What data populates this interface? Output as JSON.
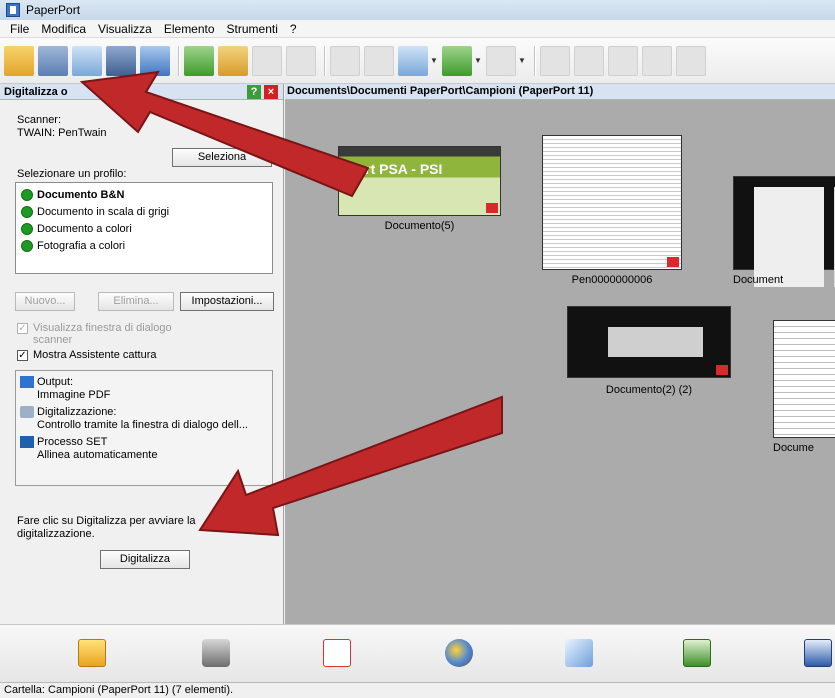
{
  "window": {
    "title": "PaperPort"
  },
  "menu": [
    "File",
    "Modifica",
    "Visualizza",
    "Elemento",
    "Strumenti",
    "?"
  ],
  "toolbar": {
    "icons": [
      "open-folder-icon",
      "scan-icon",
      "desktop-icon",
      "copy-icon",
      "info-icon",
      "new-folder-icon",
      "folder-properties-icon",
      "page-icon",
      "edit-icon",
      "view-icon",
      "thumbnails-icon",
      "sort-icon",
      "filter-icon",
      "history-icon",
      "save-icon",
      "stack-icon",
      "unstack-icon",
      "delete-icon",
      "rotate-icon"
    ]
  },
  "scan_panel": {
    "title": "Digitalizza o",
    "scanner_label": "Scanner:",
    "scanner_value": "TWAIN: PenTwain",
    "select_button": "Seleziona",
    "profile_label": "Selezionare un profilo:",
    "profiles": [
      "Documento B&N",
      "Documento in scala di grigi",
      "Documento a colori",
      "Fotografia a colori"
    ],
    "selected_profile": "Documento B&N",
    "new_button": "Nuovo...",
    "delete_button": "Elimina...",
    "settings_button": "Impostazioni...",
    "show_scanner_dialog": {
      "label": "Visualizza finestra di dialogo scanner",
      "checked": true,
      "enabled": false
    },
    "show_capture_assistant": {
      "label": "Mostra Assistente cattura",
      "checked": true,
      "enabled": true
    },
    "steps": [
      {
        "title": "Output:",
        "detail": "Immagine PDF",
        "icon": "output-arrow-icon"
      },
      {
        "title": "Digitalizzazione:",
        "detail": "Controllo tramite la finestra di dialogo dell...",
        "icon": "scanner-icon"
      },
      {
        "title": "Processo SET",
        "detail": "Allinea automaticamente",
        "icon": "process-icon"
      }
    ],
    "hint": "Fare clic su Digitalizza per avviare la digitalizzazione.",
    "scan_button": "Digitalizza"
  },
  "path": "Documents\\Documenti PaperPort\\Campioni (PaperPort 11)",
  "documents": [
    {
      "name": "Documento(5)",
      "preview_text": "ebert PSA - PSI"
    },
    {
      "name": "Pen0000000006"
    },
    {
      "name": "Document"
    },
    {
      "name": "Documento(2) (2)"
    },
    {
      "name": "Docume"
    }
  ],
  "launch_bar": [
    "slideshow-icon",
    "printer-icon",
    "pdf-icon",
    "paint-icon",
    "notepad-icon",
    "excel-icon",
    "word-icon"
  ],
  "status": "Cartella: Campioni (PaperPort 11) (7 elementi).",
  "colors": {
    "accent_arrow": "#c0282a",
    "panel_header": "#d7e3f2",
    "profile_dot": "#1c9a23"
  }
}
